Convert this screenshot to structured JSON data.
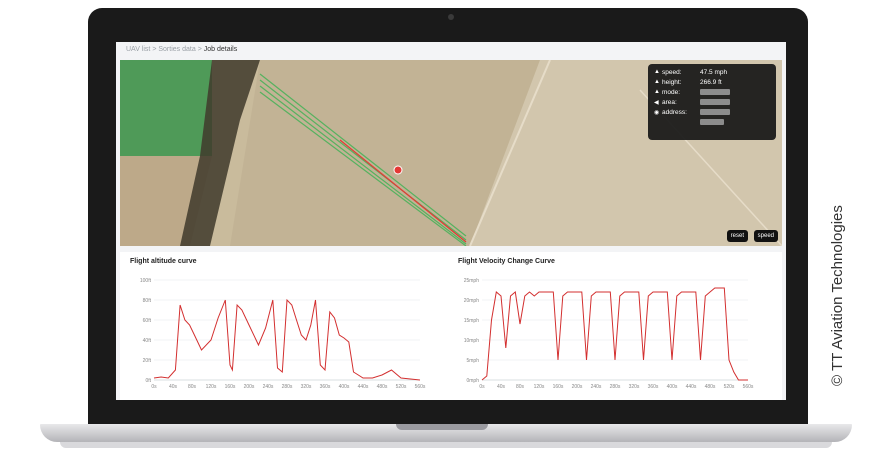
{
  "breadcrumb": {
    "items": [
      "UAV list",
      "Sorties data"
    ],
    "separator": ">",
    "current": "Job details"
  },
  "map_info": {
    "rows": [
      {
        "icon": "up-arrow-icon",
        "key": "speed:",
        "value": "47.5 mph"
      },
      {
        "icon": "up-arrow-icon",
        "key": "height:",
        "value": "266.9 ft"
      },
      {
        "icon": "up-arrow-icon",
        "key": "mode:",
        "value": ""
      },
      {
        "icon": "area-icon",
        "key": "area:",
        "value": ""
      },
      {
        "icon": "pin-icon",
        "key": "address:",
        "value": ""
      }
    ]
  },
  "map_buttons": {
    "reset": "reset",
    "speed": "speed"
  },
  "charts": {
    "altitude_title": "Flight altitude curve",
    "velocity_title": "Flight Velocity Change Curve"
  },
  "chart_data": [
    {
      "type": "line",
      "title": "Flight altitude curve",
      "y_ticks": [
        "100ft",
        "80ft",
        "60ft",
        "40ft",
        "20ft",
        "0ft"
      ],
      "ylim": [
        0,
        100
      ],
      "x_ticks": [
        "0s",
        "40s",
        "80s",
        "120s",
        "160s",
        "200s",
        "240s",
        "280s",
        "320s",
        "360s",
        "400s",
        "440s",
        "480s",
        "520s",
        "560s"
      ],
      "xlim": [
        0,
        560
      ],
      "color": "#d32f2f",
      "x": [
        0,
        15,
        30,
        45,
        55,
        65,
        75,
        85,
        100,
        120,
        135,
        150,
        160,
        165,
        175,
        185,
        200,
        220,
        235,
        250,
        260,
        270,
        280,
        290,
        300,
        310,
        320,
        330,
        340,
        350,
        360,
        370,
        380,
        390,
        400,
        410,
        420,
        430,
        440,
        460,
        480,
        500,
        520,
        540,
        560
      ],
      "y": [
        2,
        3,
        2,
        10,
        75,
        60,
        55,
        45,
        30,
        40,
        62,
        80,
        15,
        10,
        75,
        70,
        55,
        35,
        52,
        80,
        12,
        8,
        80,
        75,
        60,
        45,
        40,
        55,
        80,
        15,
        10,
        68,
        62,
        45,
        42,
        38,
        8,
        5,
        2,
        2,
        5,
        10,
        2,
        1,
        0
      ]
    },
    {
      "type": "line",
      "title": "Flight Velocity Change Curve",
      "y_ticks": [
        "25mph",
        "20mph",
        "15mph",
        "10mph",
        "5mph",
        "0mph"
      ],
      "ylim": [
        0,
        25
      ],
      "x_ticks": [
        "0s",
        "40s",
        "80s",
        "120s",
        "160s",
        "200s",
        "240s",
        "280s",
        "320s",
        "360s",
        "400s",
        "440s",
        "480s",
        "520s",
        "560s"
      ],
      "xlim": [
        0,
        560
      ],
      "color": "#d32f2f",
      "x": [
        0,
        10,
        20,
        30,
        40,
        50,
        60,
        70,
        80,
        90,
        100,
        110,
        120,
        130,
        150,
        160,
        170,
        180,
        190,
        210,
        220,
        230,
        240,
        250,
        270,
        280,
        290,
        300,
        310,
        330,
        340,
        350,
        360,
        370,
        390,
        400,
        410,
        420,
        430,
        450,
        460,
        470,
        480,
        490,
        510,
        520,
        530,
        540,
        560
      ],
      "y": [
        0,
        1,
        15,
        22,
        21,
        8,
        21,
        22,
        14,
        21,
        22,
        21,
        22,
        22,
        22,
        5,
        21,
        22,
        22,
        22,
        5,
        21,
        22,
        22,
        22,
        5,
        21,
        22,
        22,
        22,
        5,
        21,
        22,
        22,
        22,
        5,
        21,
        22,
        22,
        22,
        5,
        21,
        22,
        23,
        23,
        5,
        2,
        0,
        0
      ]
    }
  ],
  "watermark": "© TT Aviation Technologies"
}
